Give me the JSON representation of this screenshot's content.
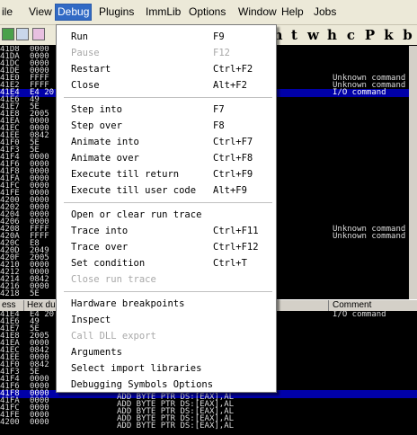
{
  "menubar": {
    "items": [
      "ile",
      "View",
      "Debug",
      "Plugins",
      "ImmLib",
      "Options",
      "Window",
      "Help",
      "Jobs"
    ],
    "active": "Debug"
  },
  "toolbar": {
    "letters": [
      "m",
      "t",
      "w",
      "h",
      "c",
      "P",
      "k",
      "b"
    ]
  },
  "top_rows": [
    {
      "addr": "41D8",
      "hex": "0000",
      "cmt": ""
    },
    {
      "addr": "41DA",
      "hex": "0000",
      "cmt": ""
    },
    {
      "addr": "41DC",
      "hex": "0000",
      "cmt": ""
    },
    {
      "addr": "41DE",
      "hex": "0000",
      "cmt": ""
    },
    {
      "addr": "41E0",
      "hex": "FFFF",
      "cmt": "Unknown command"
    },
    {
      "addr": "41E2",
      "hex": "FFFF",
      "cmt": "Unknown command"
    },
    {
      "addr": "41E4",
      "hex": "E4 20",
      "cmt": "I/O command"
    },
    {
      "addr": "41E6",
      "hex": "49",
      "cmt": ""
    },
    {
      "addr": "41E7",
      "hex": "5E",
      "cmt": ""
    },
    {
      "addr": "41E8",
      "hex": "2005",
      "cmt": ""
    },
    {
      "addr": "41EA",
      "hex": "0000",
      "cmt": ""
    },
    {
      "addr": "41EC",
      "hex": "0000",
      "cmt": ""
    },
    {
      "addr": "41EE",
      "hex": "0842",
      "cmt": ""
    },
    {
      "addr": "41F0",
      "hex": "5E",
      "cmt": ""
    },
    {
      "addr": "41F3",
      "hex": "5E",
      "cmt": ""
    },
    {
      "addr": "41F4",
      "hex": "0000",
      "cmt": ""
    },
    {
      "addr": "41F6",
      "hex": "0000",
      "cmt": ""
    },
    {
      "addr": "41F8",
      "hex": "0000",
      "cmt": ""
    },
    {
      "addr": "41FA",
      "hex": "0000",
      "cmt": ""
    },
    {
      "addr": "41FC",
      "hex": "0000",
      "cmt": ""
    },
    {
      "addr": "41FE",
      "hex": "0000",
      "cmt": ""
    },
    {
      "addr": "4200",
      "hex": "0000",
      "cmt": ""
    },
    {
      "addr": "4202",
      "hex": "0000",
      "cmt": ""
    },
    {
      "addr": "4204",
      "hex": "0000",
      "cmt": ""
    },
    {
      "addr": "4206",
      "hex": "0000",
      "cmt": ""
    },
    {
      "addr": "4208",
      "hex": "FFFF",
      "cmt": "Unknown command"
    },
    {
      "addr": "420A",
      "hex": "FFFF",
      "cmt": "Unknown command"
    },
    {
      "addr": "420C",
      "hex": "E8",
      "cmt": ""
    },
    {
      "addr": "420D",
      "hex": "2049",
      "cmt": ""
    },
    {
      "addr": "420F",
      "hex": "2005",
      "cmt": ""
    },
    {
      "addr": "4210",
      "hex": "0000",
      "cmt": ""
    },
    {
      "addr": "4212",
      "hex": "0000",
      "cmt": ""
    },
    {
      "addr": "4214",
      "hex": "0842",
      "cmt": ""
    },
    {
      "addr": "4216",
      "hex": "0000",
      "cmt": ""
    },
    {
      "addr": "4218",
      "hex": "5E",
      "cmt": ""
    }
  ],
  "top_selected_index": 6,
  "dump_header": {
    "col1": "ess",
    "col2": "Hex du",
    "col3": "Comment"
  },
  "bottom_rows": [
    {
      "addr": "41E4",
      "hex": "E4 20",
      "cmt": "I/O command"
    },
    {
      "addr": "41E6",
      "hex": "49",
      "cmt": ""
    },
    {
      "addr": "41E7",
      "hex": "5E",
      "cmt": ""
    },
    {
      "addr": "41E8",
      "hex": "2005",
      "cmt": ""
    },
    {
      "addr": "41EA",
      "hex": "0000",
      "cmt": ""
    },
    {
      "addr": "41EC",
      "hex": "0842",
      "cmt": ""
    },
    {
      "addr": "41EE",
      "hex": "0000",
      "cmt": ""
    },
    {
      "addr": "41F0",
      "hex": "0842",
      "cmt": ""
    },
    {
      "addr": "41F3",
      "hex": "5E",
      "cmt": ""
    },
    {
      "addr": "41F4",
      "hex": "0000",
      "cmt": ""
    },
    {
      "addr": "41F6",
      "hex": "0000",
      "cmt": ""
    },
    {
      "addr": "41F8",
      "hex": "0000",
      "cmt": ""
    },
    {
      "addr": "41FA",
      "hex": "0000",
      "cmt": ""
    },
    {
      "addr": "41FC",
      "hex": "0000",
      "cmt": ""
    },
    {
      "addr": "41FE",
      "hex": "0000",
      "cmt": ""
    },
    {
      "addr": "4200",
      "hex": "0000",
      "cmt": ""
    }
  ],
  "bottom_selected_index": 11,
  "disasm_lines": [
    "ADD BYTE PTR DS:[EAX],AL",
    "ADD BYTE PTR DS:[EAX],AL",
    "ADD BYTE PTR DS:[EAX],AL",
    "ADD BYTE PTR DS:[EAX],AL",
    "ADD BYTE PTR DS:[EAX],AL"
  ],
  "debug_menu": [
    {
      "label": "Run",
      "accel": "F9",
      "disabled": false
    },
    {
      "label": "Pause",
      "accel": "F12",
      "disabled": true
    },
    {
      "label": "Restart",
      "accel": "Ctrl+F2",
      "disabled": false
    },
    {
      "label": "Close",
      "accel": "Alt+F2",
      "disabled": false
    },
    {
      "sep": true
    },
    {
      "label": "Step into",
      "accel": "F7",
      "disabled": false
    },
    {
      "label": "Step over",
      "accel": "F8",
      "disabled": false
    },
    {
      "label": "Animate into",
      "accel": "Ctrl+F7",
      "disabled": false
    },
    {
      "label": "Animate over",
      "accel": "Ctrl+F8",
      "disabled": false
    },
    {
      "label": "Execute till return",
      "accel": "Ctrl+F9",
      "disabled": false
    },
    {
      "label": "Execute till user code",
      "accel": "Alt+F9",
      "disabled": false
    },
    {
      "sep": true
    },
    {
      "label": "Open or clear run trace",
      "accel": "",
      "disabled": false
    },
    {
      "label": "Trace into",
      "accel": "Ctrl+F11",
      "disabled": false
    },
    {
      "label": "Trace over",
      "accel": "Ctrl+F12",
      "disabled": false
    },
    {
      "label": "Set condition",
      "accel": "Ctrl+T",
      "disabled": false
    },
    {
      "label": "Close run trace",
      "accel": "",
      "disabled": true
    },
    {
      "sep": true
    },
    {
      "label": "Hardware breakpoints",
      "accel": "",
      "disabled": false
    },
    {
      "label": "Inspect",
      "accel": "",
      "disabled": false
    },
    {
      "label": "Call DLL export",
      "accel": "",
      "disabled": true
    },
    {
      "label": "Arguments",
      "accel": "",
      "disabled": false
    },
    {
      "label": "Select import libraries",
      "accel": "",
      "disabled": false
    },
    {
      "label": "Debugging Symbols Options",
      "accel": "",
      "disabled": false
    }
  ]
}
